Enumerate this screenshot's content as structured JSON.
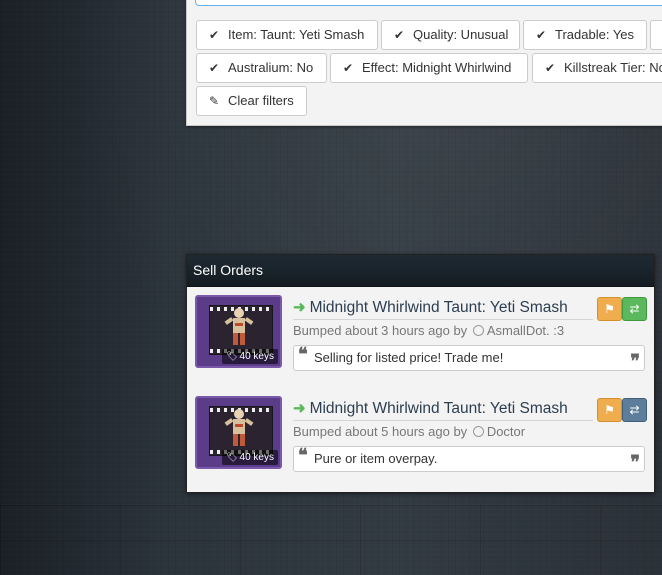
{
  "filters": {
    "chips": [
      {
        "label": "Item: Taunt: Yeti Smash",
        "icon": "check-icon"
      },
      {
        "label": "Quality: Unusual",
        "icon": "check-icon"
      },
      {
        "label": "Tradable: Yes",
        "icon": "check-icon"
      },
      {
        "label": "Australium: No",
        "icon": "check-icon"
      },
      {
        "label": "Effect: Midnight Whirlwind",
        "icon": "check-icon"
      },
      {
        "label": "Killstreak Tier: No",
        "icon": "check-icon"
      }
    ],
    "clear_label": "Clear filters"
  },
  "sell_orders": {
    "header": "Sell Orders",
    "orders": [
      {
        "title": "Midnight Whirlwind Taunt: Yeti Smash",
        "price": "40 keys",
        "bumped": "Bumped about 3 hours ago by",
        "user": "AsmallDot. :3",
        "comment": "Selling for listed price! Trade me!",
        "trade_color": "#5cb85c"
      },
      {
        "title": "Midnight Whirlwind Taunt: Yeti Smash",
        "price": "40 keys",
        "bumped": "Bumped about 5 hours ago by",
        "user": "Doctor",
        "comment": "Pure or item overpay.",
        "trade_color": "#5d7e9a"
      }
    ]
  }
}
